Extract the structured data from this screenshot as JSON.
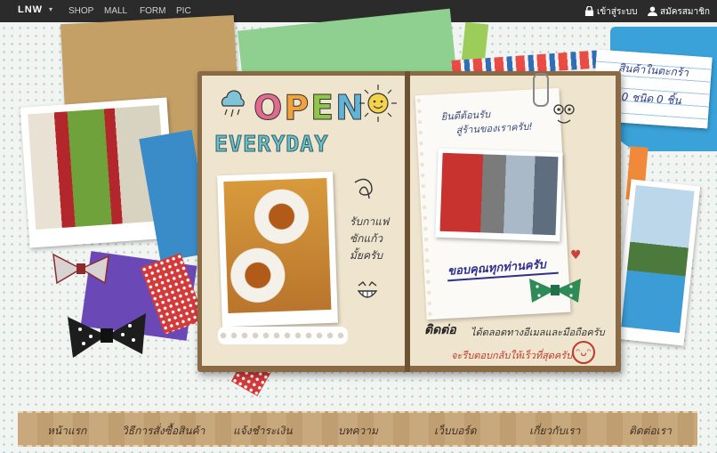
{
  "topbar": {
    "logo": "LNW",
    "caret": "▾",
    "nav": [
      "SHOP",
      "MALL",
      "FORM",
      "PIC"
    ],
    "login": "เข้าสู่ระบบ",
    "register": "สมัครสมาชิก"
  },
  "cart_card": {
    "line1": "สินค้าในตะกร้า",
    "line2": "0 ชนิด 0 ชิ้น"
  },
  "notebook": {
    "title_open": [
      "O",
      "P",
      "E",
      "N"
    ],
    "title_open_colors": [
      "#e26a8f",
      "#f0a23c",
      "#8fc64a",
      "#5fb4d8"
    ],
    "title_everyday": "EVERYDAY",
    "coffee_note": [
      "รับกาแฟ",
      "ซักแก้ว",
      "มั้ยครับ"
    ],
    "welcome": [
      "ยินดีต้อนรับ",
      "สู่ร้านของเราครับ!"
    ],
    "thanks": "ขอบคุณทุกท่านครับ",
    "contact_label": "ติดต่อ",
    "contact_text": "ได้ตลอดทางอีเมลและมือถือครับ",
    "reply_text": "จะรีบตอบกลับให้เร็วที่สุดครับ"
  },
  "menu": [
    "หน้าแรก",
    "วิธีการสั่งซื้อสินค้า",
    "แจ้งชำระเงิน",
    "บทความ",
    "เว็บบอร์ด",
    "เกี่ยวกับเรา",
    "ติดต่อเรา"
  ]
}
